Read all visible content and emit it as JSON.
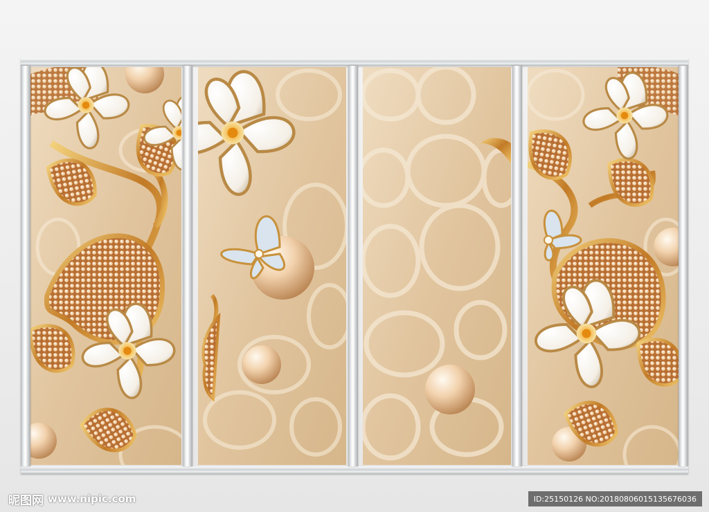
{
  "watermark": {
    "brand": "昵图网",
    "site": "www.nipic.com"
  },
  "id_bar": {
    "text": "ID:25150126 NO:20180806015135676036"
  },
  "colors": {
    "background": "#eeeeee",
    "panel_base": "#e2c8a4",
    "gold": "#c98a3c",
    "petal": "#fbf7ee",
    "frame": "#d9dbdd"
  },
  "panels": [
    "panel-1",
    "panel-2",
    "panel-3",
    "panel-4"
  ]
}
